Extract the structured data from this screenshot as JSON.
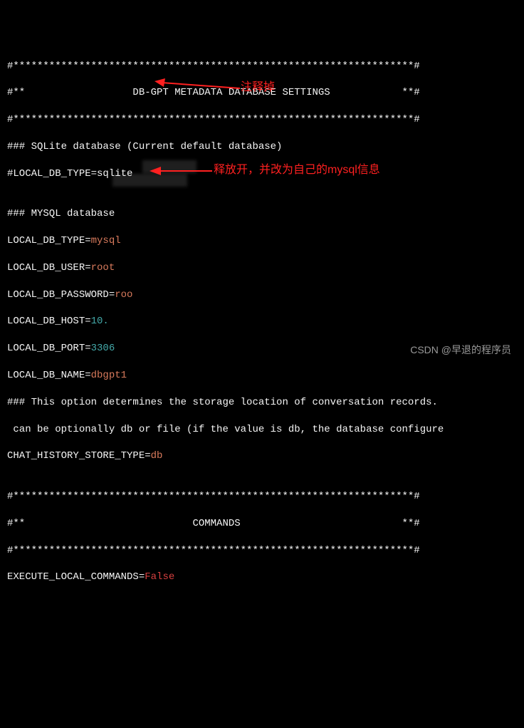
{
  "lines": {
    "border_full": "#*******************************************************************#",
    "header_title": "#**                  DB-GPT METADATA DATABASE SETTINGS            **#",
    "sqlite_header": "### SQLite database (Current default database)",
    "sqlite_local": "#LOCAL_DB_TYPE=sqlite",
    "mysql_header": "### MYSQL database",
    "mysql_type_key": "LOCAL_DB_TYPE=",
    "mysql_type_val": "mysql",
    "mysql_user_key": "LOCAL_DB_USER=",
    "mysql_user_val": "root",
    "mysql_pass_key": "LOCAL_DB_PASSWORD=",
    "mysql_pass_val": "roo",
    "mysql_host_key": "LOCAL_DB_HOST=",
    "mysql_host_val": "10.",
    "mysql_port_key": "LOCAL_DB_PORT=",
    "mysql_port_val": "3306",
    "mysql_name_key": "LOCAL_DB_NAME=",
    "mysql_name_val": "dbgpt1",
    "storage_comment1": "### This option determines the storage location of conversation records.",
    "storage_comment2": " can be optionally db or file (if the value is db, the database configure",
    "chat_key": "CHAT_HISTORY_STORE_TYPE=",
    "chat_val": "db",
    "commands_title": "#**                            COMMANDS                           **#",
    "exec_key": "EXECUTE_LOCAL_COMMANDS=",
    "exec_val": "False"
  },
  "annotations": {
    "note1": "注释掉",
    "note2": "释放开，并改为自己的mysql信息"
  },
  "watermark": "CSDN @早退的程序员"
}
